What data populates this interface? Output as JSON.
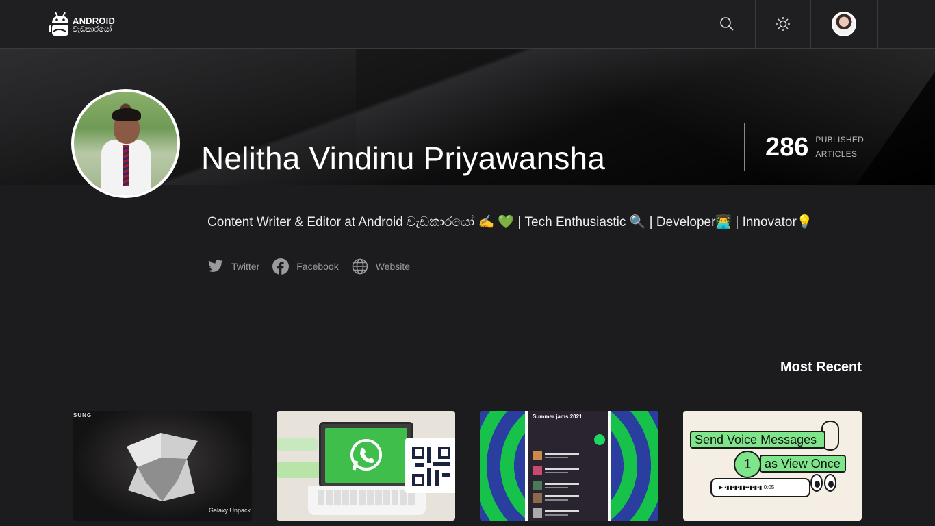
{
  "header": {
    "logo_line1": "ANDROID",
    "logo_line2": "වැඩකාරයෝ",
    "search_icon": "search-icon",
    "theme_icon": "sun-icon",
    "user_icon": "user-avatar"
  },
  "profile": {
    "name": "Nelitha Vindinu Priyawansha",
    "article_count": "286",
    "article_label_line1": "PUBLISHED",
    "article_label_line2": "ARTICLES",
    "bio": "Content Writer & Editor at Android වැඩකාරයෝ ✍️ 💚 | Tech Enthusiastic 🔍 | Developer👨‍💻 | Innovator💡",
    "socials": [
      {
        "label": "Twitter",
        "icon": "twitter-icon"
      },
      {
        "label": "Facebook",
        "icon": "facebook-icon"
      },
      {
        "label": "Website",
        "icon": "globe-icon"
      }
    ]
  },
  "recent": {
    "title": "Most Recent",
    "cards": [
      {
        "brand": "SUNG",
        "caption": "Galaxy Unpack"
      },
      {
        "icon": "whatsapp-icon"
      },
      {
        "playlist_title": "Summer jams 2021"
      },
      {
        "line1": "Send Voice Messages",
        "line2": "as View Once",
        "badge": "1",
        "time": "0:05"
      }
    ]
  },
  "colors": {
    "background": "#1c1c1f",
    "header": "#1f1f21",
    "accent_green": "#17c24a"
  }
}
